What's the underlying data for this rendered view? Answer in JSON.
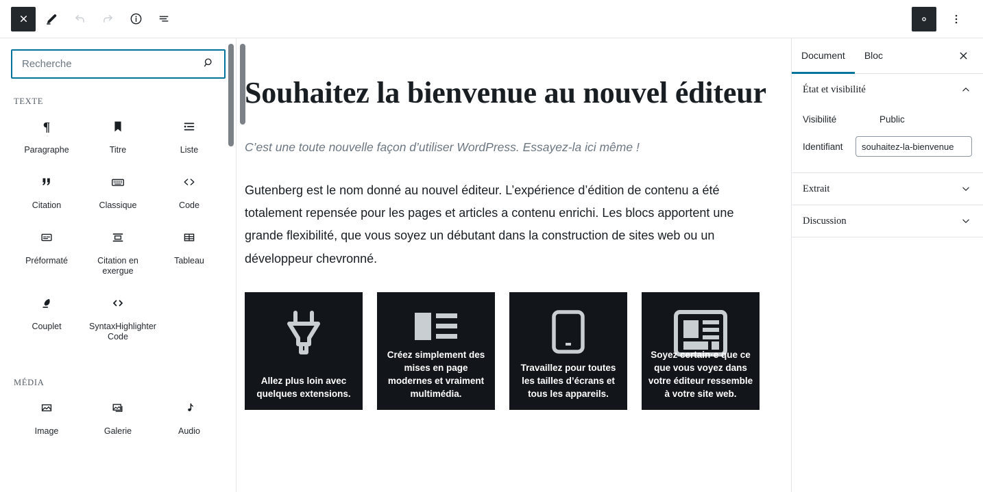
{
  "toolbar": {
    "close_label": "×",
    "close_name": "close-editor",
    "edit_label": "Modifier",
    "undo_label": "Annuler",
    "redo_label": "Rétablir",
    "info_label": "Informations sur le contenu",
    "outline_label": "Plan du contenu",
    "settings_label": "Réglages",
    "more_label": "Plus d'outils et d'options"
  },
  "inserter": {
    "search": {
      "placeholder": "Recherche",
      "value": "",
      "icon": "search-icon"
    },
    "sections": [
      {
        "title": "TEXTE",
        "blocks": [
          {
            "label": "Paragraphe",
            "icon": "paragraph-icon"
          },
          {
            "label": "Titre",
            "icon": "heading-bookmark-icon"
          },
          {
            "label": "Liste",
            "icon": "list-icon"
          },
          {
            "label": "Citation",
            "icon": "quote-icon"
          },
          {
            "label": "Classique",
            "icon": "keyboard-icon"
          },
          {
            "label": "Code",
            "icon": "code-brackets-icon"
          },
          {
            "label": "Préformaté",
            "icon": "preformatted-icon"
          },
          {
            "label": "Citation en exergue",
            "icon": "pullquote-icon"
          },
          {
            "label": "Tableau",
            "icon": "table-icon"
          },
          {
            "label": "Couplet",
            "icon": "feather-icon"
          },
          {
            "label": "SyntaxHighlighter Code",
            "icon": "code-brackets-icon"
          }
        ]
      },
      {
        "title": "MÉDIA",
        "blocks": [
          {
            "label": "Image",
            "icon": "image-icon"
          },
          {
            "label": "Galerie",
            "icon": "gallery-icon"
          },
          {
            "label": "Audio",
            "icon": "audio-note-icon"
          }
        ]
      }
    ]
  },
  "editor": {
    "title": "Souhaitez la bienvenue au nouvel éditeur",
    "subtitle": "C’est une toute nouvelle façon d’utiliser WordPress. Essayez-la ici même !",
    "paragraph": "Gutenberg est le nom donné au nouvel éditeur. L’expérience d’édition de contenu a été totalement repensée pour les pages et articles a contenu enrichi. Les blocs apportent une grande flexibilité, que vous soyez un débutant dans la construction de sites web ou un développeur chevronné.",
    "cards": [
      {
        "text": "Allez plus loin avec quelques extensions.",
        "icon": "plug-icon"
      },
      {
        "text": "Créez simplement des mises en page modernes et vraiment multimédia.",
        "icon": "layout-columns-icon"
      },
      {
        "text": "Travaillez pour toutes les tailles d’écrans et tous les appareils.",
        "icon": "tablet-icon"
      },
      {
        "text": "Soyez certain·e que ce que vous voyez dans votre éditeur ressemble à votre site web.",
        "icon": "browser-window-icon"
      }
    ]
  },
  "settings": {
    "tabs": [
      {
        "label": "Document",
        "active": true
      },
      {
        "label": "Bloc",
        "active": false
      }
    ],
    "close_label": "×",
    "panels": [
      {
        "title": "État et visibilité",
        "expanded": true,
        "rows": [
          {
            "label": "Visibilité",
            "value": "Public"
          },
          {
            "label": "Identifiant",
            "value": "souhaitez-la-bienvenue"
          }
        ]
      },
      {
        "title": "Extrait",
        "expanded": false
      },
      {
        "title": "Discussion",
        "expanded": false
      }
    ]
  },
  "colors": {
    "accent": "#00739c",
    "dark": "#23282d",
    "card_bg": "#12161a",
    "border": "#e2e4e7",
    "muted": "#6c7781"
  }
}
